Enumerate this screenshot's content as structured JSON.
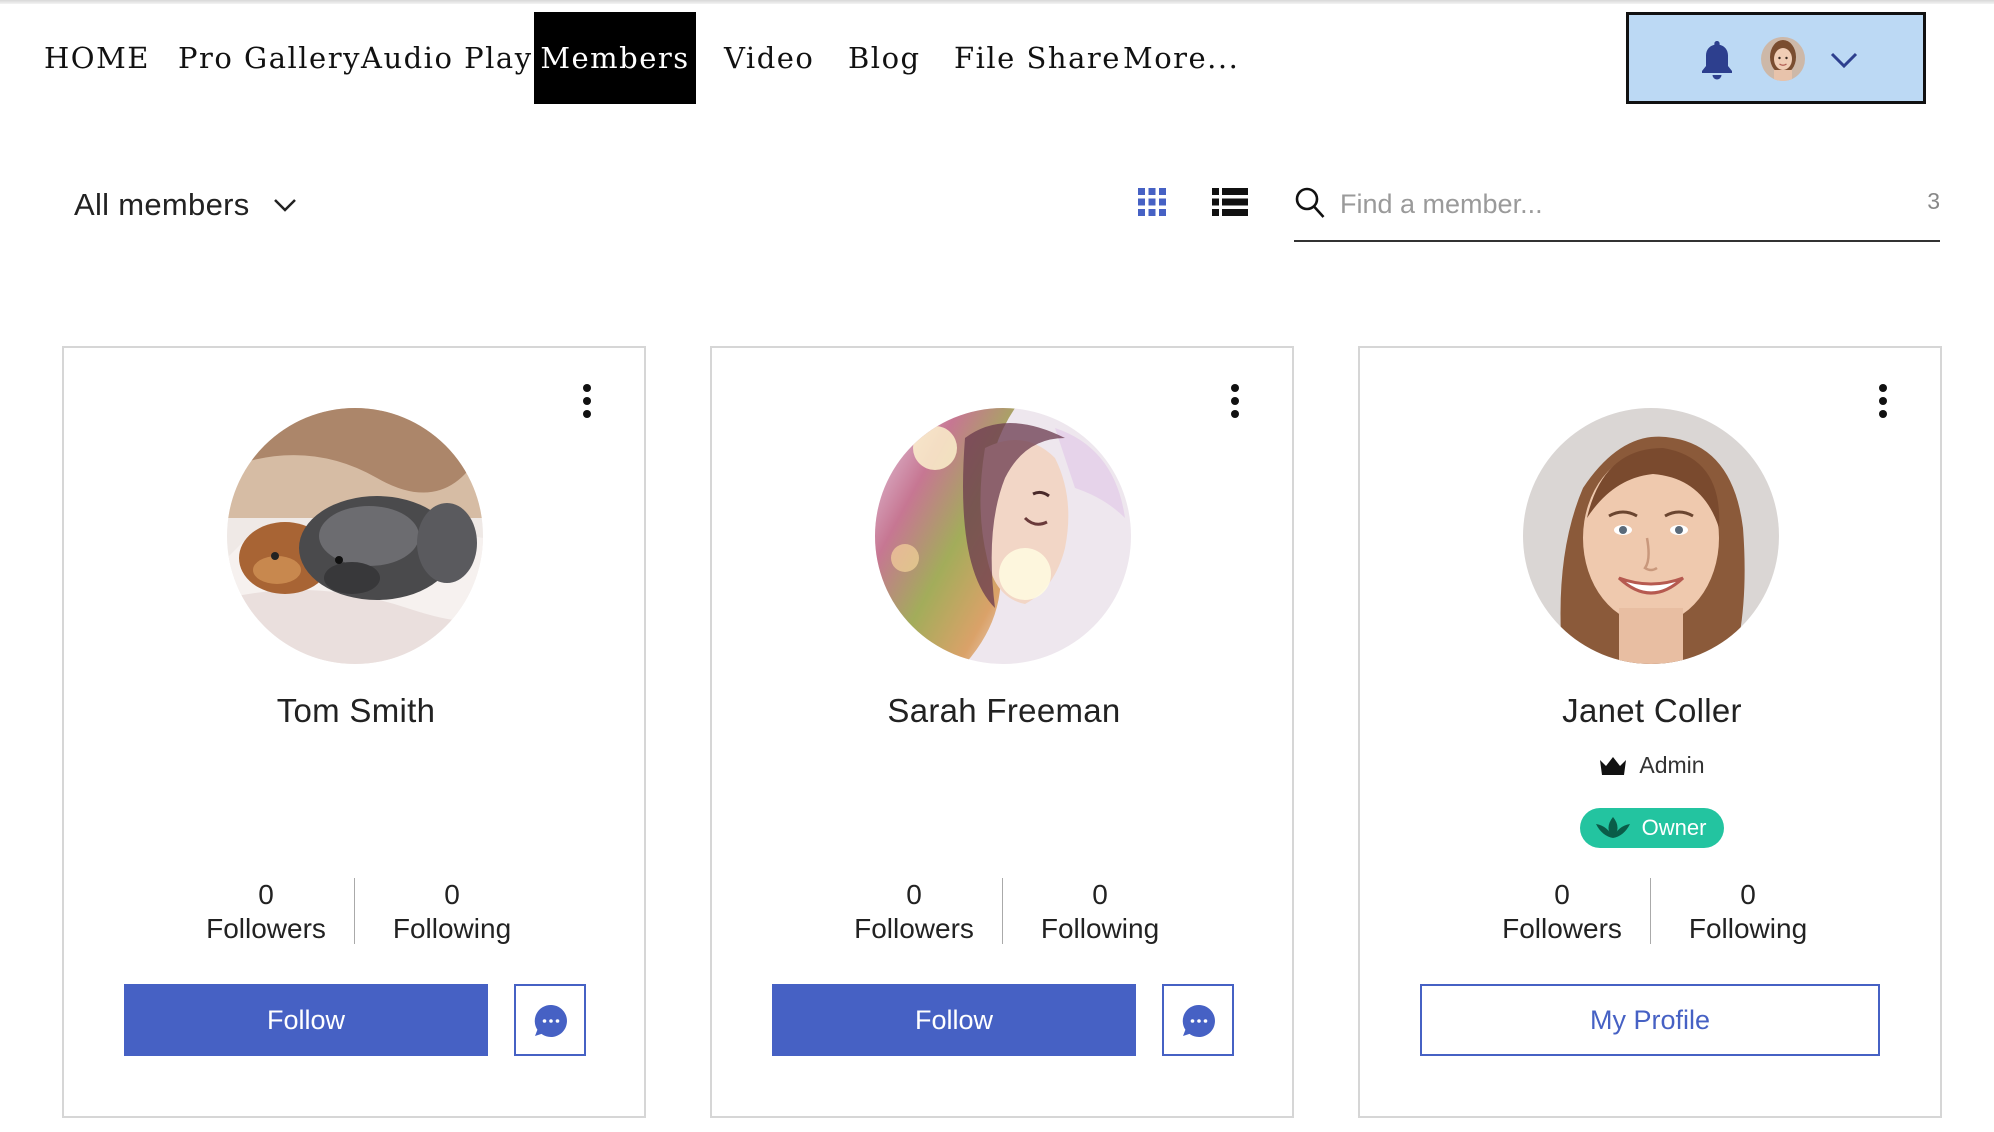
{
  "nav": {
    "items": [
      {
        "label": "HOME"
      },
      {
        "label": "Pro Gallery"
      },
      {
        "label": "Audio Player"
      },
      {
        "label": "Members",
        "active": true
      },
      {
        "label": "Video"
      },
      {
        "label": "Blog"
      },
      {
        "label": "File Share"
      },
      {
        "label": "More..."
      }
    ],
    "account": {
      "icons": [
        "bell-icon",
        "user-avatar",
        "chevron-down-icon"
      ],
      "background": "#bcd9f4"
    }
  },
  "filter": {
    "label": "All members"
  },
  "view_toggle": {
    "grid": "grid-icon",
    "list": "list-icon",
    "active": "grid"
  },
  "search": {
    "placeholder": "Find a member...",
    "value": "",
    "count": "3"
  },
  "members": [
    {
      "name": "Tom Smith",
      "followers_count": "0",
      "followers_label": "Followers",
      "following_count": "0",
      "following_label": "Following",
      "primary_action": "Follow"
    },
    {
      "name": "Sarah Freeman",
      "followers_count": "0",
      "followers_label": "Followers",
      "following_count": "0",
      "following_label": "Following",
      "primary_action": "Follow"
    },
    {
      "name": "Janet Coller",
      "role": "Admin",
      "badge": "Owner",
      "followers_count": "0",
      "followers_label": "Followers",
      "following_count": "0",
      "following_label": "Following",
      "primary_action": "My Profile"
    }
  ],
  "colors": {
    "accent": "#4661c4",
    "badge": "#23c4a0",
    "active_nav": "#000000"
  }
}
